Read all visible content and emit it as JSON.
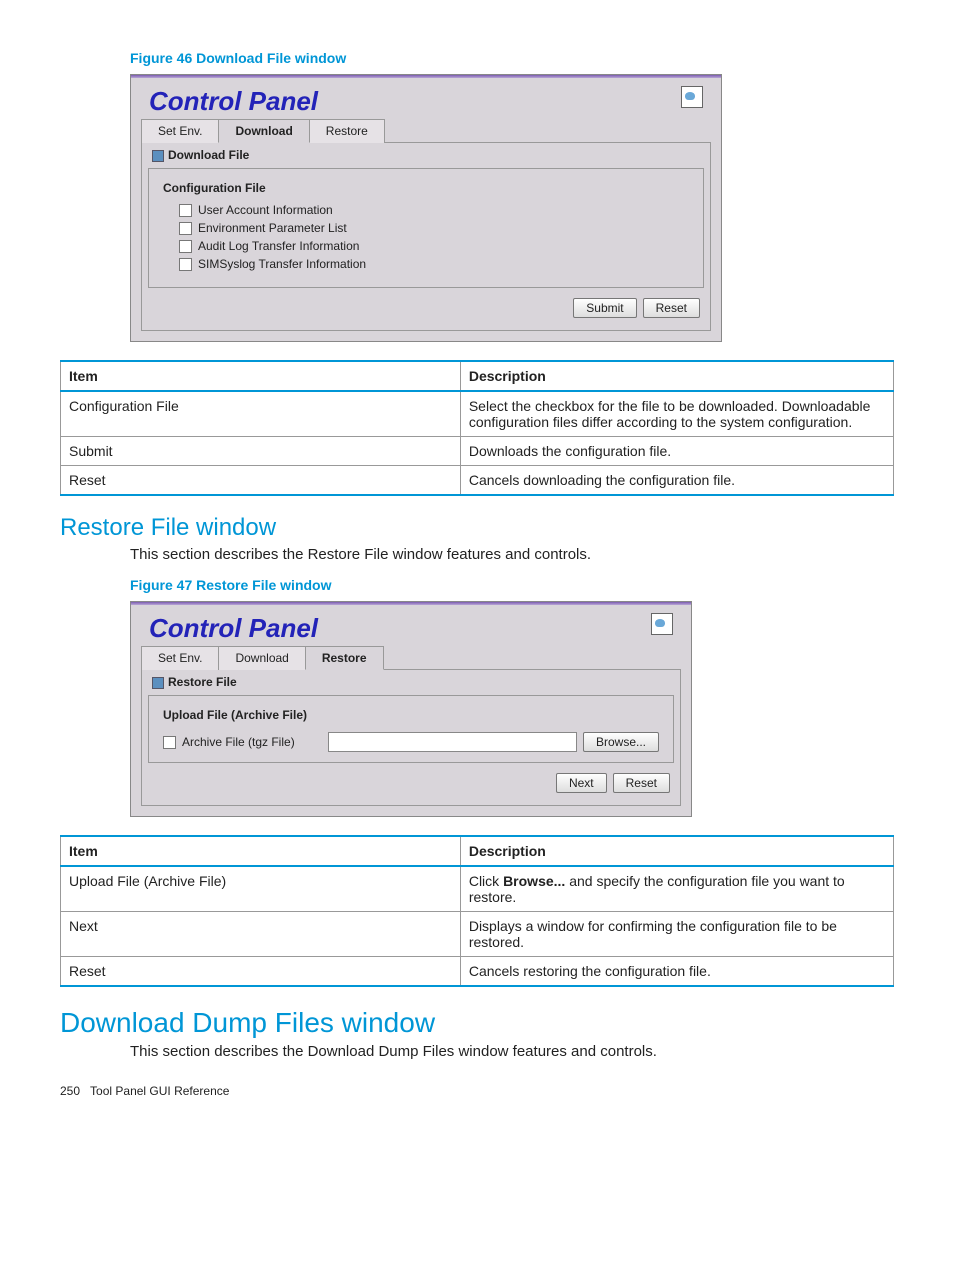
{
  "fig46": {
    "caption": "Figure 46 Download File window",
    "cpTitle": "Control Panel",
    "tabs": [
      "Set Env.",
      "Download",
      "Restore"
    ],
    "activeTabIndex": 1,
    "subTab": "Download File",
    "sectionLabel": "Configuration File",
    "checks": [
      "User Account Information",
      "Environment Parameter List",
      "Audit Log Transfer Information",
      "SIMSyslog Transfer Information"
    ],
    "buttons": {
      "submit": "Submit",
      "reset": "Reset"
    }
  },
  "table1": {
    "headers": [
      "Item",
      "Description"
    ],
    "rows": [
      [
        "Configuration File",
        "Select the checkbox for the file to be downloaded. Downloadable configuration files differ according to the system configuration."
      ],
      [
        "Submit",
        "Downloads the configuration file."
      ],
      [
        "Reset",
        "Cancels downloading the configuration file."
      ]
    ]
  },
  "sec2": {
    "heading": "Restore File window",
    "desc": "This section describes the Restore File window features and controls."
  },
  "fig47": {
    "caption": "Figure 47 Restore File window",
    "cpTitle": "Control Panel",
    "tabs": [
      "Set Env.",
      "Download",
      "Restore"
    ],
    "activeTabIndex": 2,
    "subTab": "Restore File",
    "sectionLabel": "Upload File (Archive File)",
    "archiveLabel": "Archive File (tgz File)",
    "browseBtn": "Browse...",
    "buttons": {
      "next": "Next",
      "reset": "Reset"
    }
  },
  "table2": {
    "headers": [
      "Item",
      "Description"
    ],
    "rows": [
      [
        "Upload File (Archive File)",
        "Click <b>Browse...</b> and specify the configuration file you want to restore."
      ],
      [
        "Next",
        "Displays a window for confirming the configuration file to be restored."
      ],
      [
        "Reset",
        "Cancels restoring the configuration file."
      ]
    ]
  },
  "sec3": {
    "heading": "Download Dump Files window",
    "desc": "This section describes the Download Dump Files window features and controls."
  },
  "footer": {
    "page": "250",
    "chapter": "Tool Panel GUI Reference"
  }
}
